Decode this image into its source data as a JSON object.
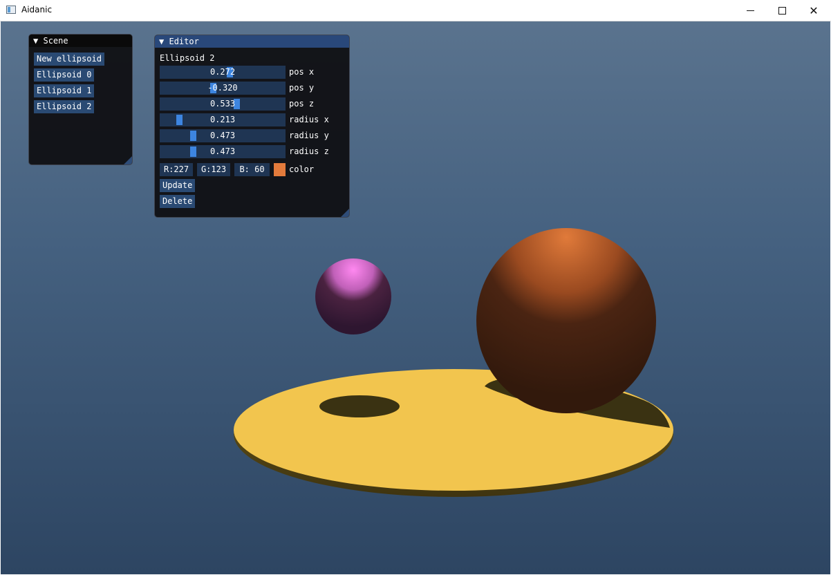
{
  "window": {
    "title": "Aidanic",
    "minimize": "",
    "maximize": "",
    "close": "✕"
  },
  "scene_panel": {
    "title": "Scene",
    "buttons": [
      "New ellipsoid",
      "Ellipsoid 0",
      "Ellipsoid 1",
      "Ellipsoid 2"
    ]
  },
  "editor_panel": {
    "title": "Editor",
    "selected": "Ellipsoid 2",
    "sliders": [
      {
        "label": "pos x",
        "value": "0.272",
        "level": 0.56
      },
      {
        "label": "pos y",
        "value": "-0.320",
        "level": 0.42
      },
      {
        "label": "pos z",
        "value": "0.533",
        "level": 0.62
      },
      {
        "label": "radius x",
        "value": "0.213",
        "level": 0.13
      },
      {
        "label": "radius y",
        "value": "0.473",
        "level": 0.25
      },
      {
        "label": "radius z",
        "value": "0.473",
        "level": 0.25
      }
    ],
    "color": {
      "r": "R:227",
      "g": "G:123",
      "b": "B: 60",
      "label": "color",
      "swatch": "#e37b3c"
    },
    "update_button": "Update",
    "delete_button": "Delete"
  },
  "colors": {
    "panel_header_active": "#29487a",
    "button": "#2a4a73",
    "slider_grab": "#3d85e0",
    "platform": "#f2c54e",
    "pink_sphere": "#f07ce0",
    "orange_sphere": "#e37b3c"
  }
}
